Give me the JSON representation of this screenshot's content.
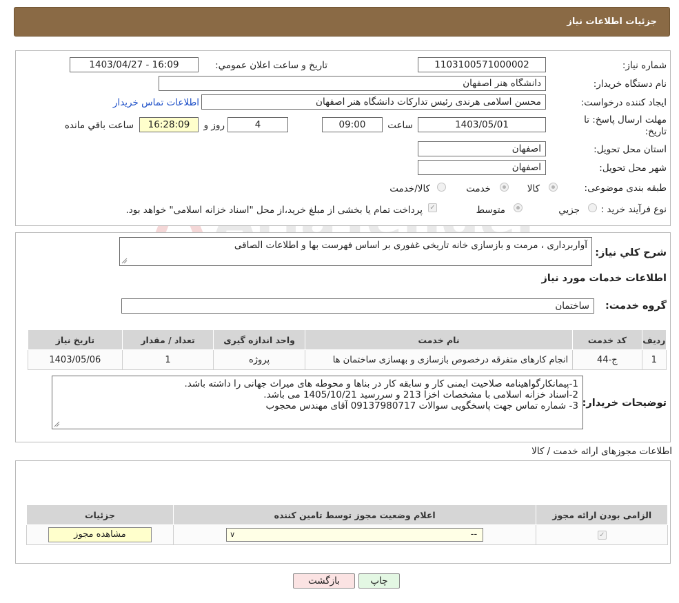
{
  "header": {
    "title": "جزئیات اطلاعات نیاز"
  },
  "form": {
    "need_number_label": "شماره نیاز:",
    "need_number": "1103100571000002",
    "announce_label": "تاریخ و ساعت اعلان عمومي:",
    "announce_value": "1403/04/27 - 16:09",
    "buyer_org_label": "نام دستگاه خريدار:",
    "buyer_org": "دانشگاه هنر اصفهان",
    "requester_label": "ايجاد کننده درخواست:",
    "requester": "محسن اسلامی هرندی رئیس تدارکات دانشگاه هنر اصفهان",
    "contact_link": "اطلاعات تماس خريدار",
    "deadline_label_1": "مهلت ارسال پاسخ: تا",
    "deadline_label_2": "تاريخ:",
    "deadline_date": "1403/05/01",
    "time_label": "ساعت",
    "deadline_time": "09:00",
    "days_value": "4",
    "days_label": "روز و",
    "remaining_time": "16:28:09",
    "remaining_label": "ساعت باقي مانده",
    "province_label": "استان محل تحویل:",
    "province": "اصفهان",
    "city_label": "شهر محل تحویل:",
    "city": "اصفهان",
    "category_label": "طبقه بندی موضوعی:",
    "category_options": [
      "کالا",
      "خدمت",
      "کالا/خدمت"
    ],
    "process_label": "نوع فرآيند خريد :",
    "process_options": [
      "جزيي",
      "متوسط"
    ],
    "payment_note": "پرداخت تمام يا بخشی از مبلغ خريد،از محل \"اسناد خزانه اسلامی\" خواهد بود."
  },
  "summary": {
    "label": "شرح کلي نياز:",
    "text": "آواربرداری ، مرمت و بازسازی خانه تاریخی غفوری بر اساس فهرست بها و اطلاعات الصاقی",
    "services_title": "اطلاعات خدمات مورد نياز",
    "service_group_label": "گروه خدمت:",
    "service_group": "ساختمان"
  },
  "services_table": {
    "headers": [
      "رديف",
      "کد خدمت",
      "نام خدمت",
      "واحد اندازه گيری",
      "تعداد / مقدار",
      "تاريخ نياز"
    ],
    "rows": [
      [
        "1",
        "ج-44",
        "انجام کارهای متفرقه درخصوص بازسازی و بهسازی ساختمان ها",
        "پروژه",
        "1",
        "1403/05/06"
      ]
    ]
  },
  "buyer_notes": {
    "label": "توضيحات خريدار:",
    "lines": [
      "1-پیمانکارگواهینامه صلاحیت ایمنی کار و سابقه کار در بناها و محوطه های میراث جهانی را داشته باشد.",
      "2-اسناد خزانه اسلامی با مشخصات اخزا 213 و سررسید 1405/10/21 می باشد.",
      "3- شماره تماس جهت پاسخگویی سوالات 09137980717 آقای مهندس محجوب"
    ]
  },
  "permits": {
    "title": "اطلاعات مجوزهای ارائه خدمت / کالا",
    "headers": [
      "الزامی بودن ارائه مجوز",
      "اعلام وضعيت مجوز توسط تامين کننده",
      "جزئيات"
    ],
    "select_value": "--",
    "view_button": "مشاهده مجوز"
  },
  "buttons": {
    "print": "چاپ",
    "back": "بازگشت"
  },
  "watermark": {
    "text": "AriaTender.neT"
  },
  "colors": {
    "header_bg": "#8a6a45",
    "link": "#1e50c8",
    "highlight": "#ffffcc",
    "back_button": "#fbe3e3",
    "print_button": "#e3f7e3"
  }
}
